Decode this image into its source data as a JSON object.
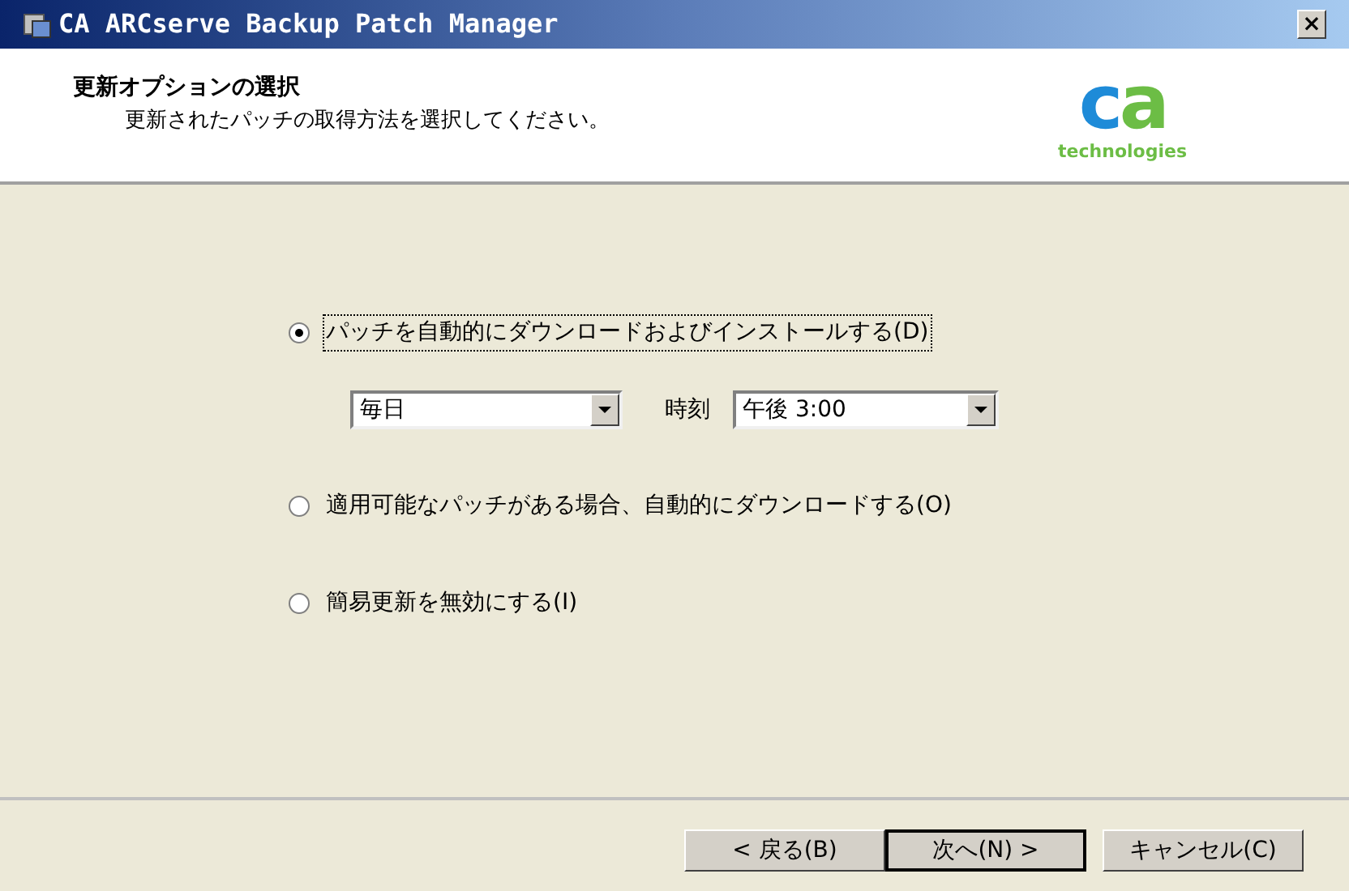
{
  "window": {
    "title": "CA ARCserve Backup Patch Manager",
    "close": "×"
  },
  "header": {
    "title": "更新オプションの選択",
    "subtitle": "更新されたパッチの取得方法を選択してください。",
    "logo": {
      "letter_1": "c",
      "letter_2": "a",
      "tagline": "technologies"
    }
  },
  "options": [
    {
      "label": "パッチを自動的にダウンロードおよびインストールする(D)",
      "selected": true,
      "focused": true
    },
    {
      "label": "適用可能なパッチがある場合、自動的にダウンロードする(O)",
      "selected": false,
      "focused": false
    },
    {
      "label": "簡易更新を無効にする(I)",
      "selected": false,
      "focused": false
    }
  ],
  "schedule": {
    "frequency": "毎日",
    "time_label": "時刻",
    "time": "午後 3:00"
  },
  "buttons": [
    {
      "label": "< 戻る(B)",
      "default": false
    },
    {
      "label": "次へ(N) >",
      "default": true
    },
    {
      "label": "キャンセル(C)",
      "default": false
    }
  ]
}
